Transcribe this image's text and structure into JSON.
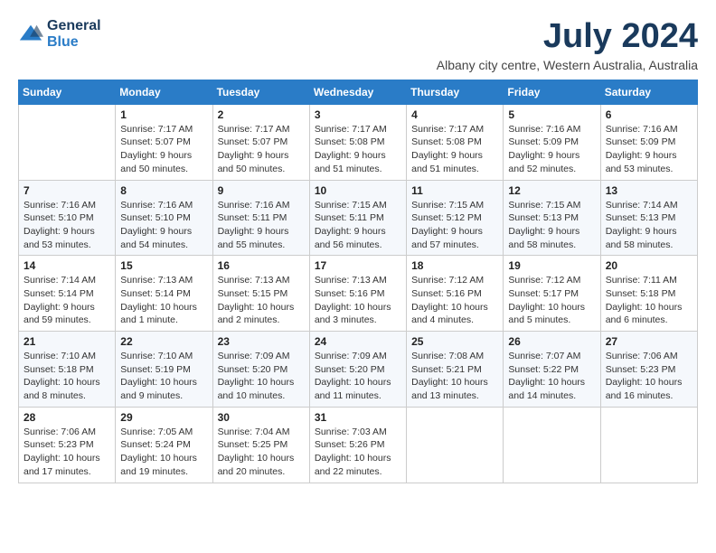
{
  "logo": {
    "line1": "General",
    "line2": "Blue"
  },
  "title": "July 2024",
  "location": "Albany city centre, Western Australia, Australia",
  "days_header": [
    "Sunday",
    "Monday",
    "Tuesday",
    "Wednesday",
    "Thursday",
    "Friday",
    "Saturday"
  ],
  "weeks": [
    [
      {
        "day": "",
        "info": ""
      },
      {
        "day": "1",
        "info": "Sunrise: 7:17 AM\nSunset: 5:07 PM\nDaylight: 9 hours\nand 50 minutes."
      },
      {
        "day": "2",
        "info": "Sunrise: 7:17 AM\nSunset: 5:07 PM\nDaylight: 9 hours\nand 50 minutes."
      },
      {
        "day": "3",
        "info": "Sunrise: 7:17 AM\nSunset: 5:08 PM\nDaylight: 9 hours\nand 51 minutes."
      },
      {
        "day": "4",
        "info": "Sunrise: 7:17 AM\nSunset: 5:08 PM\nDaylight: 9 hours\nand 51 minutes."
      },
      {
        "day": "5",
        "info": "Sunrise: 7:16 AM\nSunset: 5:09 PM\nDaylight: 9 hours\nand 52 minutes."
      },
      {
        "day": "6",
        "info": "Sunrise: 7:16 AM\nSunset: 5:09 PM\nDaylight: 9 hours\nand 53 minutes."
      }
    ],
    [
      {
        "day": "7",
        "info": "Sunrise: 7:16 AM\nSunset: 5:10 PM\nDaylight: 9 hours\nand 53 minutes."
      },
      {
        "day": "8",
        "info": "Sunrise: 7:16 AM\nSunset: 5:10 PM\nDaylight: 9 hours\nand 54 minutes."
      },
      {
        "day": "9",
        "info": "Sunrise: 7:16 AM\nSunset: 5:11 PM\nDaylight: 9 hours\nand 55 minutes."
      },
      {
        "day": "10",
        "info": "Sunrise: 7:15 AM\nSunset: 5:11 PM\nDaylight: 9 hours\nand 56 minutes."
      },
      {
        "day": "11",
        "info": "Sunrise: 7:15 AM\nSunset: 5:12 PM\nDaylight: 9 hours\nand 57 minutes."
      },
      {
        "day": "12",
        "info": "Sunrise: 7:15 AM\nSunset: 5:13 PM\nDaylight: 9 hours\nand 58 minutes."
      },
      {
        "day": "13",
        "info": "Sunrise: 7:14 AM\nSunset: 5:13 PM\nDaylight: 9 hours\nand 58 minutes."
      }
    ],
    [
      {
        "day": "14",
        "info": "Sunrise: 7:14 AM\nSunset: 5:14 PM\nDaylight: 9 hours\nand 59 minutes."
      },
      {
        "day": "15",
        "info": "Sunrise: 7:13 AM\nSunset: 5:14 PM\nDaylight: 10 hours\nand 1 minute."
      },
      {
        "day": "16",
        "info": "Sunrise: 7:13 AM\nSunset: 5:15 PM\nDaylight: 10 hours\nand 2 minutes."
      },
      {
        "day": "17",
        "info": "Sunrise: 7:13 AM\nSunset: 5:16 PM\nDaylight: 10 hours\nand 3 minutes."
      },
      {
        "day": "18",
        "info": "Sunrise: 7:12 AM\nSunset: 5:16 PM\nDaylight: 10 hours\nand 4 minutes."
      },
      {
        "day": "19",
        "info": "Sunrise: 7:12 AM\nSunset: 5:17 PM\nDaylight: 10 hours\nand 5 minutes."
      },
      {
        "day": "20",
        "info": "Sunrise: 7:11 AM\nSunset: 5:18 PM\nDaylight: 10 hours\nand 6 minutes."
      }
    ],
    [
      {
        "day": "21",
        "info": "Sunrise: 7:10 AM\nSunset: 5:18 PM\nDaylight: 10 hours\nand 8 minutes."
      },
      {
        "day": "22",
        "info": "Sunrise: 7:10 AM\nSunset: 5:19 PM\nDaylight: 10 hours\nand 9 minutes."
      },
      {
        "day": "23",
        "info": "Sunrise: 7:09 AM\nSunset: 5:20 PM\nDaylight: 10 hours\nand 10 minutes."
      },
      {
        "day": "24",
        "info": "Sunrise: 7:09 AM\nSunset: 5:20 PM\nDaylight: 10 hours\nand 11 minutes."
      },
      {
        "day": "25",
        "info": "Sunrise: 7:08 AM\nSunset: 5:21 PM\nDaylight: 10 hours\nand 13 minutes."
      },
      {
        "day": "26",
        "info": "Sunrise: 7:07 AM\nSunset: 5:22 PM\nDaylight: 10 hours\nand 14 minutes."
      },
      {
        "day": "27",
        "info": "Sunrise: 7:06 AM\nSunset: 5:23 PM\nDaylight: 10 hours\nand 16 minutes."
      }
    ],
    [
      {
        "day": "28",
        "info": "Sunrise: 7:06 AM\nSunset: 5:23 PM\nDaylight: 10 hours\nand 17 minutes."
      },
      {
        "day": "29",
        "info": "Sunrise: 7:05 AM\nSunset: 5:24 PM\nDaylight: 10 hours\nand 19 minutes."
      },
      {
        "day": "30",
        "info": "Sunrise: 7:04 AM\nSunset: 5:25 PM\nDaylight: 10 hours\nand 20 minutes."
      },
      {
        "day": "31",
        "info": "Sunrise: 7:03 AM\nSunset: 5:26 PM\nDaylight: 10 hours\nand 22 minutes."
      },
      {
        "day": "",
        "info": ""
      },
      {
        "day": "",
        "info": ""
      },
      {
        "day": "",
        "info": ""
      }
    ]
  ]
}
